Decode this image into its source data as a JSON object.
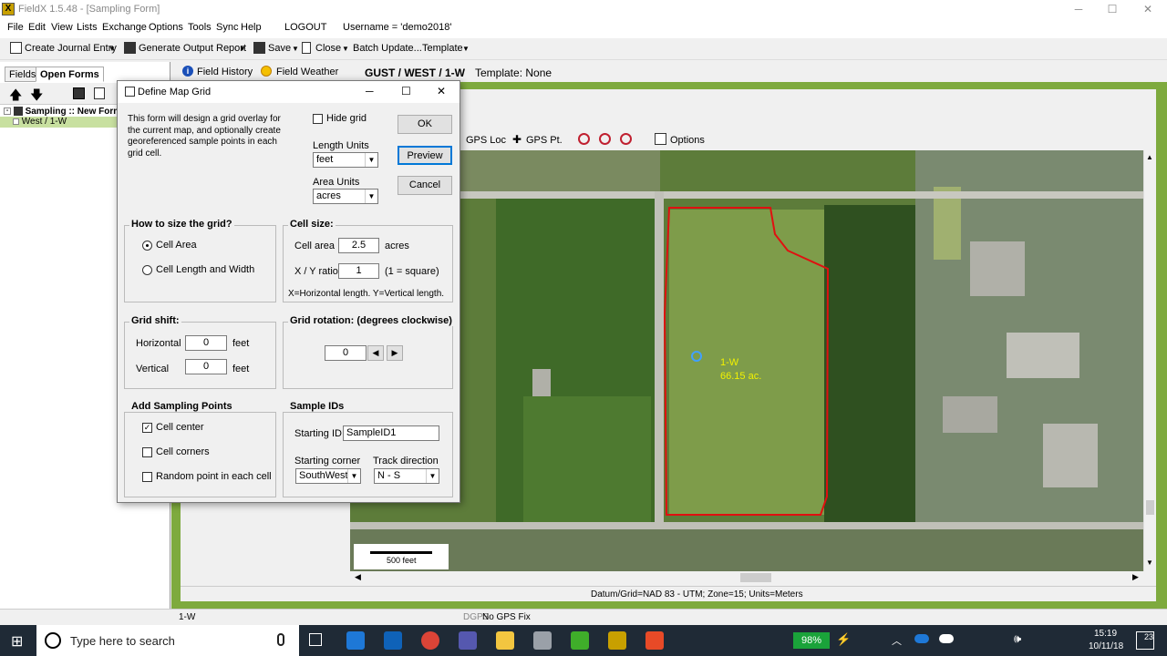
{
  "app": {
    "title": "FieldX 1.5.48 - [Sampling Form]",
    "icon_letter": "X"
  },
  "window_controls": {
    "minimize": "─",
    "maximize": "☐",
    "close": "✕"
  },
  "menubar": {
    "items": [
      "File",
      "Edit",
      "View",
      "Lists",
      "Exchange",
      "Options",
      "Tools",
      "Sync",
      "Help"
    ],
    "logout": "LOGOUT",
    "username": "Username = 'demo2018'"
  },
  "toolbar": {
    "create_journal": "Create Journal Entry",
    "generate_report": "Generate Output Report",
    "save": "Save",
    "close": "Close",
    "batch_update": "Batch Update...",
    "template": "Template"
  },
  "left_pane": {
    "tab_fields": "Fields",
    "tab_open_forms": "Open Forms",
    "tree_root": "Sampling :: New Form",
    "tree_child": "West / 1-W"
  },
  "form_tabs": {
    "field_history": "Field History",
    "field_weather": "Field Weather",
    "field_path": "GUST / WEST / 1-W",
    "template": "Template: None"
  },
  "map_toolbar": {
    "gps_loc": "GPS Loc",
    "gps_pt": "GPS Pt.",
    "options": "Options"
  },
  "map": {
    "field_label": "1-W",
    "field_area": "66.15 ac.",
    "scale_label": "500 feet",
    "datum": "Datum/Grid=NAD 83 - UTM; Zone=15; Units=Meters",
    "colors": {
      "boundary": "#e01010",
      "label": "#f2f200"
    }
  },
  "statusbar": {
    "field": "1-W",
    "dgps": "DGPS",
    "gps_status": "No GPS Fix"
  },
  "dialog": {
    "title": "Define Map Grid",
    "description": "This form will design a grid overlay for the current map, and optionally create georeferenced sample points in each grid cell.",
    "hide_grid": "Hide grid",
    "length_units_label": "Length Units",
    "length_units_value": "feet",
    "area_units_label": "Area Units",
    "area_units_value": "acres",
    "ok": "OK",
    "preview": "Preview",
    "cancel": "Cancel",
    "how_to_size": {
      "title": "How to size the grid?",
      "option_area": "Cell Area",
      "option_length": "Cell Length and Width",
      "selected": "Cell Area"
    },
    "cell_size": {
      "title": "Cell size:",
      "cell_area_label": "Cell area",
      "cell_area_value": "2.5",
      "cell_area_unit": "acres",
      "xy_label": "X / Y ratio",
      "xy_value": "1",
      "xy_note": "(1 = square)",
      "footnote": "X=Horizontal length.  Y=Vertical length."
    },
    "grid_shift": {
      "title": "Grid shift:",
      "horizontal_label": "Horizontal",
      "horizontal_value": "0",
      "vertical_label": "Vertical",
      "vertical_value": "0",
      "unit": "feet"
    },
    "grid_rotation": {
      "title": "Grid rotation: (degrees clockwise)",
      "value": "0"
    },
    "sampling_points": {
      "title": "Add Sampling Points",
      "cell_center": "Cell center",
      "cell_corners": "Cell corners",
      "random_point": "Random point in each cell"
    },
    "sample_ids": {
      "title": "Sample IDs",
      "starting_id_label": "Starting ID",
      "starting_id_value": "SampleID1",
      "starting_corner_label": "Starting corner",
      "starting_corner_value": "SouthWest",
      "track_direction_label": "Track direction",
      "track_direction_value": "N - S"
    }
  },
  "taskbar": {
    "search_placeholder": "Type here to search",
    "battery": "98%",
    "time": "15:19",
    "date": "10/11/18",
    "notifications": "23"
  }
}
